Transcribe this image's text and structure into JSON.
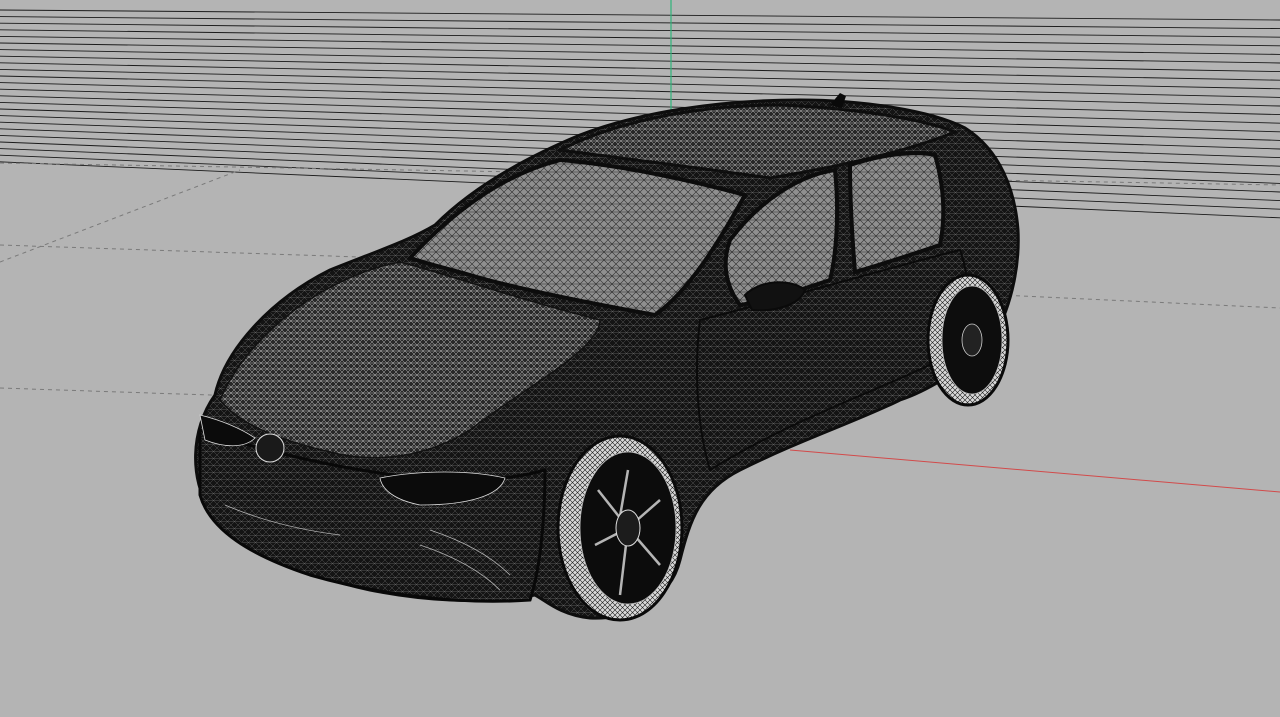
{
  "viewport": {
    "background_color": "#b4b4b4",
    "grid_line_color": "#1a1a1a",
    "grid_dashed_color": "#7a7a7a",
    "axis_x_color": "#d24a4a",
    "axis_y_color": "#2fb37a",
    "model_color": "#111111",
    "mesh_color": "#dcdcdc",
    "view_mode": "wireframe"
  },
  "scene": {
    "object_name": "",
    "object_type": "car-wireframe-mesh"
  }
}
